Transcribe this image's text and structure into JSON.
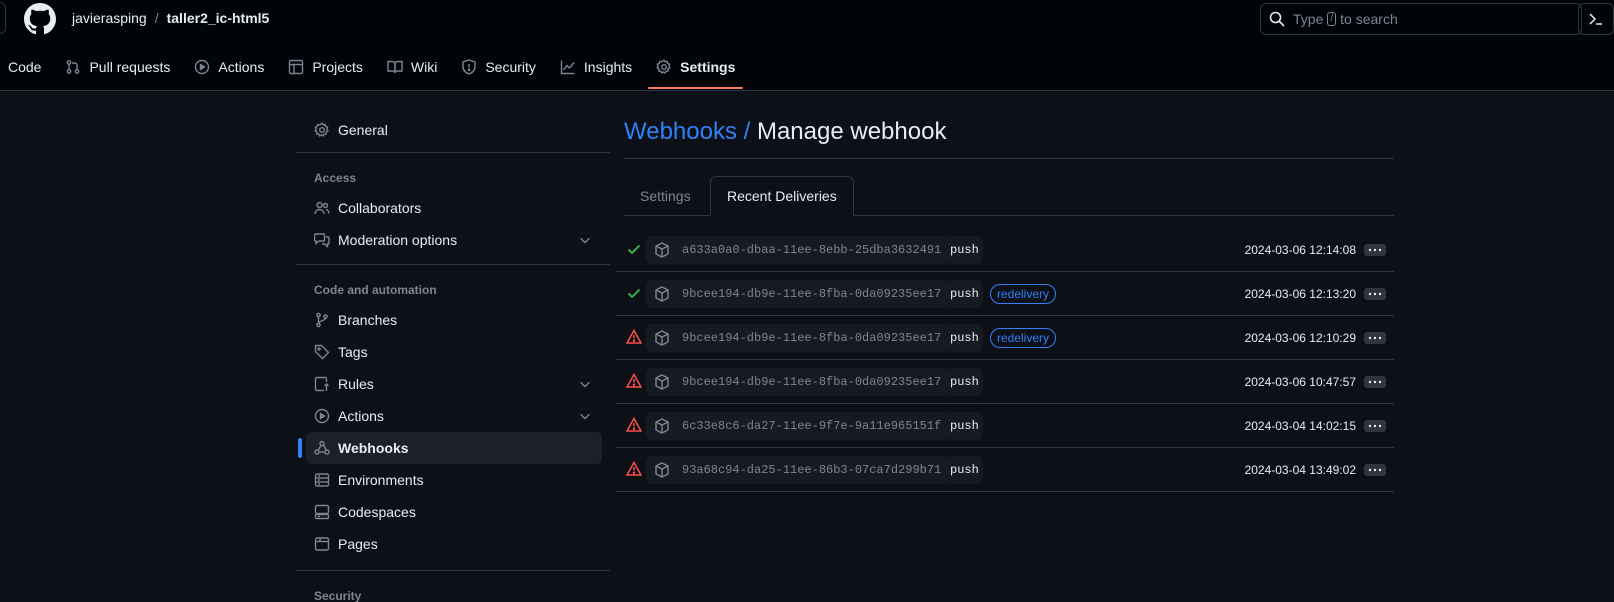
{
  "header": {
    "owner": "javierasping",
    "separator": "/",
    "repo": "taller2_ic-html5",
    "search": {
      "prefix": "Type",
      "key": "/",
      "suffix": "to search"
    }
  },
  "repo_tabs": [
    {
      "label": "Code",
      "icon": "code-icon"
    },
    {
      "label": "Pull requests",
      "icon": "pull-request-icon"
    },
    {
      "label": "Actions",
      "icon": "play-icon"
    },
    {
      "label": "Projects",
      "icon": "table-icon"
    },
    {
      "label": "Wiki",
      "icon": "book-icon"
    },
    {
      "label": "Security",
      "icon": "shield-icon"
    },
    {
      "label": "Insights",
      "icon": "graph-icon"
    },
    {
      "label": "Settings",
      "icon": "gear-icon",
      "active": true
    }
  ],
  "sidebar": {
    "general": "General",
    "access_heading": "Access",
    "collaborators": "Collaborators",
    "moderation": "Moderation options",
    "code_heading": "Code and automation",
    "branches": "Branches",
    "tags": "Tags",
    "rules": "Rules",
    "actions": "Actions",
    "webhooks": "Webhooks",
    "environments": "Environments",
    "codespaces": "Codespaces",
    "pages": "Pages",
    "security_heading": "Security"
  },
  "main": {
    "title_link": "Webhooks /",
    "title": "Manage webhook",
    "tabs": {
      "settings": "Settings",
      "recent": "Recent Deliveries"
    },
    "deliveries": [
      {
        "status": "success",
        "guid": "a633a0a0-dbaa-11ee-8ebb-25dba3632491",
        "event": "push",
        "redelivery": "",
        "time": "2024-03-06 12:14:08"
      },
      {
        "status": "success",
        "guid": "9bcee194-db9e-11ee-8fba-0da09235ee17",
        "event": "push",
        "redelivery": "redelivery",
        "time": "2024-03-06 12:13:20"
      },
      {
        "status": "failure",
        "guid": "9bcee194-db9e-11ee-8fba-0da09235ee17",
        "event": "push",
        "redelivery": "redelivery",
        "time": "2024-03-06 12:10:29"
      },
      {
        "status": "failure",
        "guid": "9bcee194-db9e-11ee-8fba-0da09235ee17",
        "event": "push",
        "redelivery": "",
        "time": "2024-03-06 10:47:57"
      },
      {
        "status": "failure",
        "guid": "6c33e8c6-da27-11ee-9f7e-9a11e965151f",
        "event": "push",
        "redelivery": "",
        "time": "2024-03-04 14:02:15"
      },
      {
        "status": "failure",
        "guid": "93a68c94-da25-11ee-86b3-07ca7d299b71",
        "event": "push",
        "redelivery": "",
        "time": "2024-03-04 13:49:02"
      }
    ]
  },
  "colors": {
    "success": "#3fb950",
    "failure": "#f85149",
    "accent": "#2f81f7",
    "tab_underline": "#f78166"
  }
}
